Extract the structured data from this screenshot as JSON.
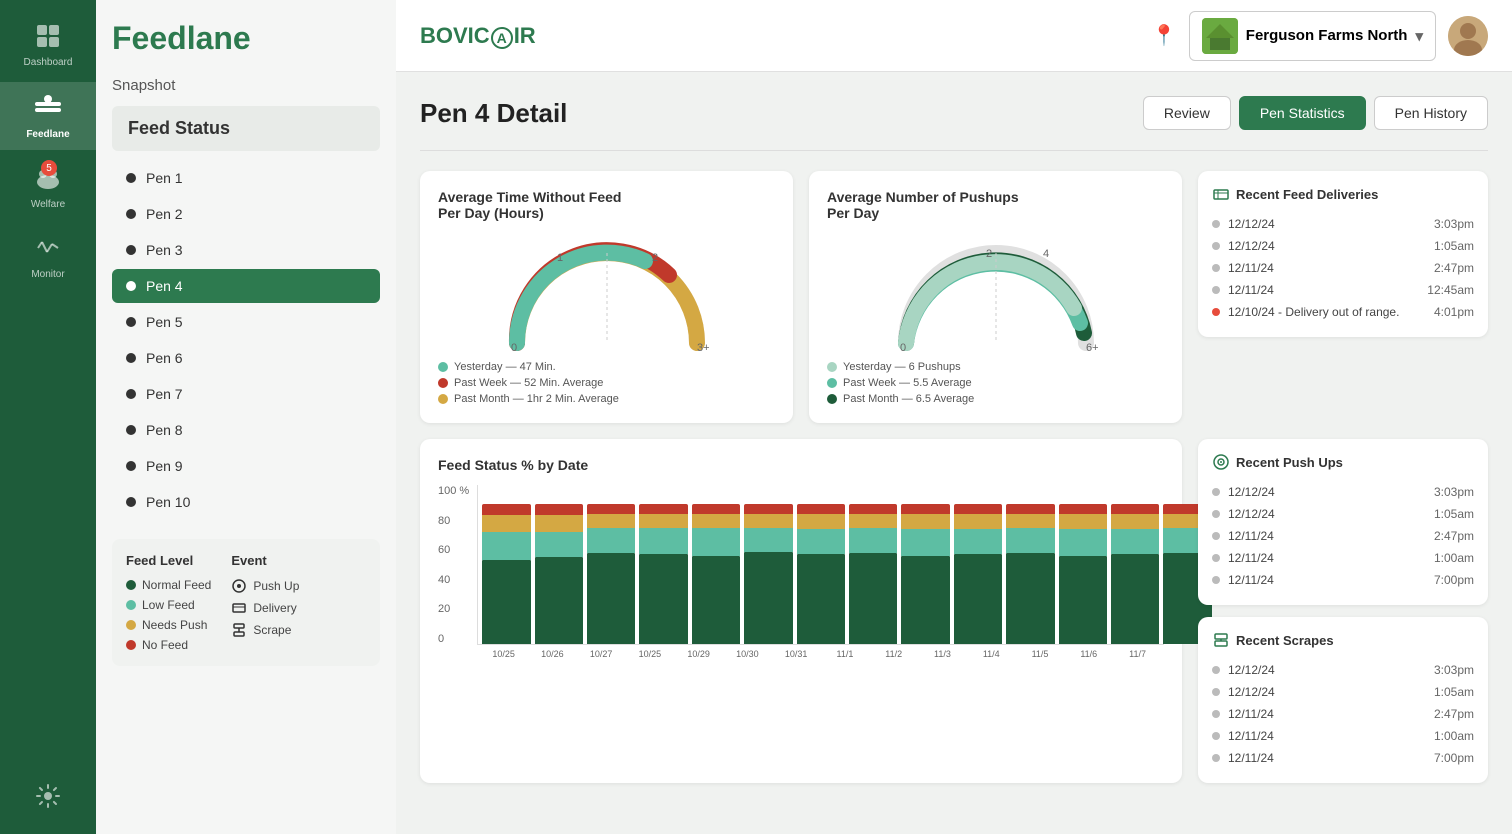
{
  "app": {
    "title": "Feedlane"
  },
  "sidebar": {
    "items": [
      {
        "id": "dashboard",
        "label": "Dashboard",
        "icon": "🏠",
        "active": false
      },
      {
        "id": "feedlane",
        "label": "Feedlane",
        "icon": "🌾",
        "active": true
      },
      {
        "id": "welfare",
        "label": "Welfare",
        "icon": "🐄",
        "active": false,
        "badge": "5"
      },
      {
        "id": "monitor",
        "label": "Monitor",
        "icon": "⚙",
        "active": false
      },
      {
        "id": "settings",
        "label": "Settings",
        "icon": "⚙",
        "active": false
      }
    ]
  },
  "leftPanel": {
    "title": "Feedlane",
    "snapshot": "Snapshot",
    "feedStatus": "Feed Status",
    "pens": [
      {
        "id": "pen1",
        "label": "Pen 1",
        "active": false
      },
      {
        "id": "pen2",
        "label": "Pen 2",
        "active": false
      },
      {
        "id": "pen3",
        "label": "Pen 3",
        "active": false
      },
      {
        "id": "pen4",
        "label": "Pen 4",
        "active": true
      },
      {
        "id": "pen5",
        "label": "Pen 5",
        "active": false
      },
      {
        "id": "pen6",
        "label": "Pen 6",
        "active": false
      },
      {
        "id": "pen7",
        "label": "Pen 7",
        "active": false
      },
      {
        "id": "pen8",
        "label": "Pen 8",
        "active": false
      },
      {
        "id": "pen9",
        "label": "Pen 9",
        "active": false
      },
      {
        "id": "pen10",
        "label": "Pen 10",
        "active": false
      }
    ],
    "legend": {
      "feedLevelTitle": "Feed Level",
      "eventTitle": "Event",
      "feedItems": [
        {
          "label": "Normal Feed",
          "color": "#1e5c3a"
        },
        {
          "label": "Low Feed",
          "color": "#5dbea3"
        },
        {
          "label": "Needs Push",
          "color": "#d4a843"
        },
        {
          "label": "No Feed",
          "color": "#c0392b"
        }
      ],
      "eventItems": [
        {
          "label": "Push Up",
          "icon": "⚙"
        },
        {
          "label": "Delivery",
          "icon": "⚙"
        },
        {
          "label": "Scrape",
          "icon": "⚙"
        }
      ]
    }
  },
  "topNav": {
    "logo": "BOVICAIR",
    "farmName": "Ferguson Farms North",
    "locationIcon": "📍"
  },
  "page": {
    "title": "Pen 4 Detail",
    "actions": {
      "review": "Review",
      "penStatistics": "Pen Statistics",
      "penHistory": "Pen History"
    }
  },
  "gaugeChart1": {
    "title": "Average Time Without Feed\nPer Day (Hours)",
    "labels": {
      "left": "0",
      "mid1": "1",
      "mid2": "2",
      "right": "3+"
    },
    "legend": [
      {
        "color": "#5dbea3",
        "text": "Yesterday — 47 Min."
      },
      {
        "color": "#c0392b",
        "text": "Past Week — 52 Min. Average"
      },
      {
        "color": "#d4a843",
        "text": "Past Month — 1hr 2 Min. Average"
      }
    ]
  },
  "gaugeChart2": {
    "title": "Average Number of Pushups\nPer Day",
    "labels": {
      "left": "0",
      "mid1": "2",
      "mid2": "4",
      "right": "6+"
    },
    "legend": [
      {
        "color": "#a8d5c2",
        "text": "Yesterday — 6 Pushups"
      },
      {
        "color": "#5dbea3",
        "text": "Past Week — 5.5 Average"
      },
      {
        "color": "#1e5c3a",
        "text": "Past Month — 6.5 Average"
      }
    ]
  },
  "recentFeedDeliveries": {
    "title": "Recent Feed Deliveries",
    "items": [
      {
        "date": "12/12/24",
        "time": "3:03pm",
        "alert": false
      },
      {
        "date": "12/12/24",
        "time": "1:05am",
        "alert": false
      },
      {
        "date": "12/11/24",
        "time": "2:47pm",
        "alert": false
      },
      {
        "date": "12/11/24",
        "time": "12:45am",
        "alert": false
      },
      {
        "date": "12/10/24 - Delivery out of range.",
        "time": "4:01pm",
        "alert": true
      }
    ]
  },
  "recentPushUps": {
    "title": "Recent Push Ups",
    "items": [
      {
        "date": "12/12/24",
        "time": "3:03pm"
      },
      {
        "date": "12/12/24",
        "time": "1:05am"
      },
      {
        "date": "12/11/24",
        "time": "2:47pm"
      },
      {
        "date": "12/11/24",
        "time": "1:00am"
      },
      {
        "date": "12/11/24",
        "time": "7:00pm"
      }
    ]
  },
  "recentScrapes": {
    "title": "Recent Scrapes",
    "items": [
      {
        "date": "12/12/24",
        "time": "3:03pm"
      },
      {
        "date": "12/12/24",
        "time": "1:05am"
      },
      {
        "date": "12/11/24",
        "time": "2:47pm"
      },
      {
        "date": "12/11/24",
        "time": "1:00am"
      },
      {
        "date": "12/11/24",
        "time": "7:00pm"
      }
    ]
  },
  "barChart": {
    "title": "Feed Status % by Date",
    "yLabels": [
      "100 %",
      "80",
      "60",
      "40",
      "20",
      "0"
    ],
    "dates": [
      "10/25",
      "10/26",
      "10/27",
      "10/25",
      "10/29",
      "10/30",
      "10/31",
      "11/1",
      "11/2",
      "11/3",
      "11/4",
      "11/5",
      "11/6",
      "11/7"
    ],
    "colors": {
      "normalFeed": "#1e5c3a",
      "lowFeed": "#5dbea3",
      "needsPush": "#d4a843",
      "noFeed": "#c0392b"
    },
    "bars": [
      {
        "normal": 60,
        "low": 20,
        "needs": 12,
        "no": 8
      },
      {
        "normal": 62,
        "low": 18,
        "needs": 12,
        "no": 8
      },
      {
        "normal": 65,
        "low": 18,
        "needs": 10,
        "no": 7
      },
      {
        "normal": 64,
        "low": 19,
        "needs": 10,
        "no": 7
      },
      {
        "normal": 63,
        "low": 20,
        "needs": 10,
        "no": 7
      },
      {
        "normal": 66,
        "low": 17,
        "needs": 10,
        "no": 7
      },
      {
        "normal": 64,
        "low": 18,
        "needs": 11,
        "no": 7
      },
      {
        "normal": 65,
        "low": 18,
        "needs": 10,
        "no": 7
      },
      {
        "normal": 63,
        "low": 19,
        "needs": 11,
        "no": 7
      },
      {
        "normal": 64,
        "low": 18,
        "needs": 11,
        "no": 7
      },
      {
        "normal": 65,
        "low": 18,
        "needs": 10,
        "no": 7
      },
      {
        "normal": 63,
        "low": 19,
        "needs": 11,
        "no": 7
      },
      {
        "normal": 64,
        "low": 18,
        "needs": 11,
        "no": 7
      },
      {
        "normal": 65,
        "low": 18,
        "needs": 10,
        "no": 7
      }
    ]
  }
}
